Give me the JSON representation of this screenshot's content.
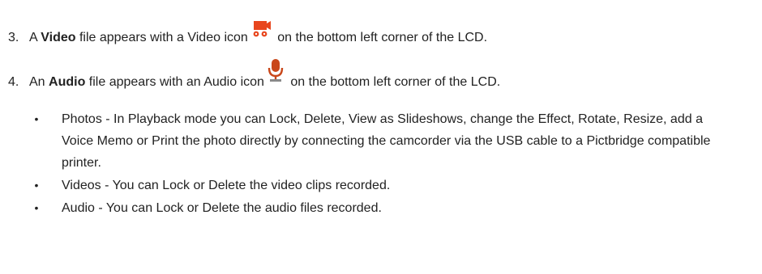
{
  "steps": [
    {
      "number": "3.",
      "prefix": "A ",
      "bold": "Video",
      "middle": " file appears with a Video icon",
      "suffix": " on the bottom left corner of the LCD.",
      "icon": "video-icon",
      "icon_color": "#e8461e"
    },
    {
      "number": "4.",
      "prefix": "An ",
      "bold": "Audio",
      "middle": " file appears with an Audio icon",
      "suffix": " on the bottom left corner of the LCD.",
      "icon": "microphone-icon",
      "icon_color": "#c9471a"
    }
  ],
  "bullets": [
    {
      "symbol": "•",
      "text": "Photos - In Playback mode you can Lock, Delete, View as Slideshows, change the Effect, Rotate, Resize, add a Voice Memo or Print the photo directly by connecting the camcorder via the USB cable to a Pictbridge compatible printer."
    },
    {
      "symbol": "•",
      "text": "Videos - You can Lock or Delete the video clips recorded."
    },
    {
      "symbol": "•",
      "text": "Audio - You can Lock or Delete the audio files recorded."
    }
  ]
}
